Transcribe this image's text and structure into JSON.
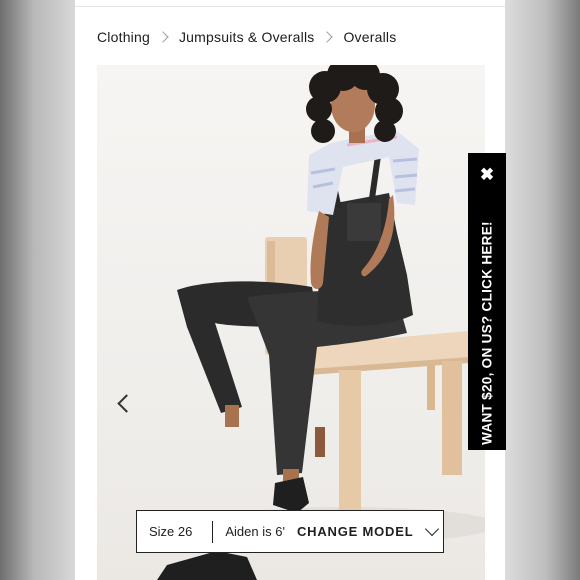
{
  "breadcrumb": {
    "items": [
      "Clothing",
      "Jumpsuits & Overalls",
      "Overalls"
    ]
  },
  "gallery": {
    "image_alt": "Model wearing black denim overalls seated on a wooden chair",
    "prev_icon": "chevron-left-icon"
  },
  "model_bar": {
    "size": "Size 26",
    "model": "Aiden is 6'",
    "change_label": "CHANGE MODEL",
    "chevron_icon": "chevron-down-icon"
  },
  "promo": {
    "text": "WANT $20, ON US? CLICK HERE!",
    "close_icon": "close-icon",
    "close_glyph": "✖"
  },
  "colors": {
    "promo_background": "#000000",
    "page_background": "#ffffff",
    "text": "#1d1d1d"
  }
}
